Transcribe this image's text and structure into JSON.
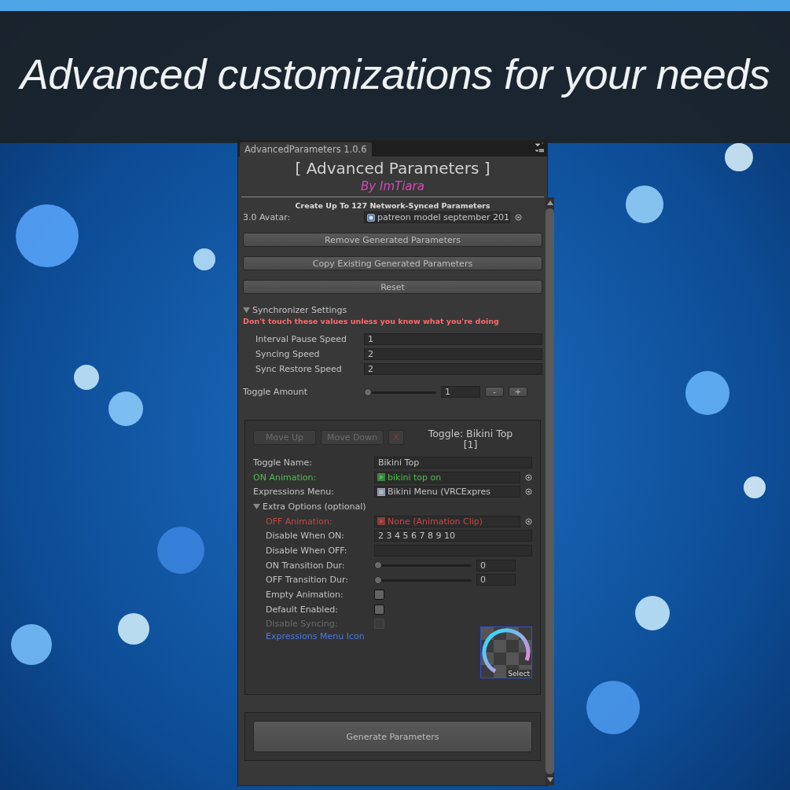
{
  "banner": {
    "headline": "Advanced customizations for your needs"
  },
  "window": {
    "tab_title": "AdvancedParameters 1.0.6",
    "title": "[ Advanced Parameters ]",
    "author": "By ImTiara",
    "subtitle": "Create Up To 127 Network-Synced Parameters",
    "avatar": {
      "label": "3.0 Avatar:",
      "value": "patreon model september 201"
    },
    "buttons": [
      "Remove Generated Parameters",
      "Copy Existing Generated Parameters",
      "Reset"
    ],
    "section": {
      "title": "Synchronizer Settings",
      "expanded": true,
      "warning": "Don't touch these values unless you know what you're doing",
      "fields": [
        {
          "label": "Interval Pause Speed",
          "value": "1"
        },
        {
          "label": "Syncing Speed",
          "value": "2"
        },
        {
          "label": "Sync Restore Speed",
          "value": "2"
        }
      ]
    },
    "toggle_amount": {
      "label": "Toggle Amount",
      "level": 0,
      "value": "1",
      "buttons": [
        "-",
        "+"
      ]
    },
    "toggle_card": {
      "move_buttons": [
        {
          "label": "Move Up",
          "disabled": true
        },
        {
          "label": "Move Down",
          "disabled": true
        }
      ],
      "delete": "X",
      "heading": [
        "Toggle: Bikini Top",
        "[1]"
      ],
      "rows": [
        {
          "kind": "text",
          "label": "Toggle Name:",
          "color": "#c4c4c4",
          "value": "Bikini Top"
        },
        {
          "kind": "clip",
          "label": "ON Animation:",
          "color": "#4fbf4f",
          "value": "bikini top on"
        },
        {
          "kind": "menu",
          "label": "Expressions Menu:",
          "color": "#c4c4c4",
          "value": "Bikini Menu (VRCExpres"
        },
        {
          "kind": "foldout",
          "label": "Extra Options (optional)",
          "color": "#c4c4c4",
          "expanded": true,
          "children": [
            {
              "kind": "clip",
              "label": "OFF Animation:",
              "color": "#c24a4a",
              "value": "None (Animation Clip)"
            },
            {
              "kind": "text",
              "label": "Disable When ON:",
              "color": "#c4c4c4",
              "value": "2 3 4 5 6 7 8 9 10"
            },
            {
              "kind": "text",
              "label": "Disable When OFF:",
              "color": "#c4c4c4"
            },
            {
              "kind": "slider",
              "label": "ON Transition Dur:",
              "color": "#c4c4c4",
              "level": 0,
              "value": "0"
            },
            {
              "kind": "slider",
              "label": "OFF Transition Dur:",
              "color": "#c4c4c4",
              "level": 0,
              "value": "0"
            },
            {
              "kind": "checkbox",
              "label": "Empty Animation:",
              "color": "#c4c4c4",
              "checked": false,
              "disabled": false
            },
            {
              "kind": "checkbox",
              "label": "Default Enabled:",
              "color": "#c4c4c4",
              "checked": false,
              "disabled": false
            },
            {
              "kind": "checkbox",
              "label": "Disable Syncing:",
              "checked": false,
              "disabled": true
            },
            {
              "kind": "icon",
              "label": "Expressions Menu Icon",
              "color": "#4a78e0",
              "button": "Select"
            }
          ]
        }
      ]
    },
    "generate": "Generate Parameters"
  }
}
